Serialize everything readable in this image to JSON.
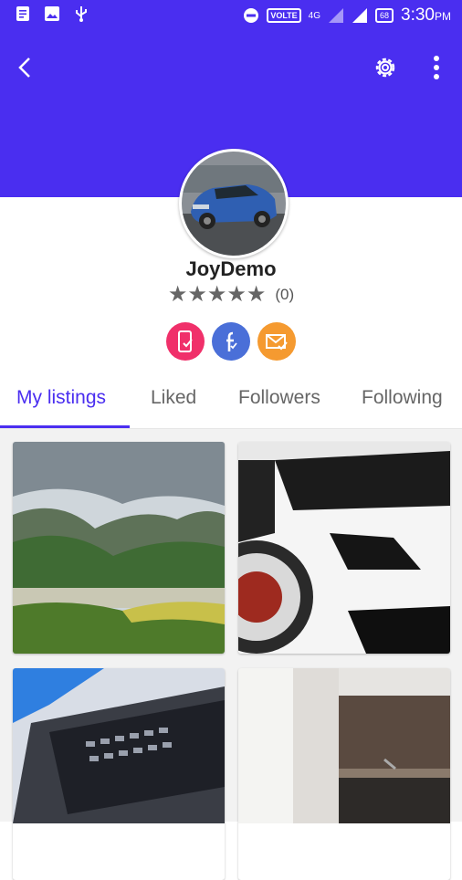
{
  "status_bar": {
    "volte": "VOLTE",
    "network": "4G",
    "battery": "68",
    "time": "3:30",
    "ampm": "PM"
  },
  "profile": {
    "username": "JoyDemo",
    "stars": "★★★★★",
    "rating_count": "(0)"
  },
  "tabs": [
    "My listings",
    "Liked",
    "Followers",
    "Following"
  ],
  "colors": {
    "primary": "#4a2ef0",
    "phone_badge": "#f0306a",
    "facebook_badge": "#4a6fd8",
    "email_badge": "#f59a30"
  },
  "icons": [
    "back-arrow-icon",
    "settings-icon",
    "more-vertical-icon",
    "phone-verified-icon",
    "facebook-icon",
    "email-verified-icon"
  ]
}
